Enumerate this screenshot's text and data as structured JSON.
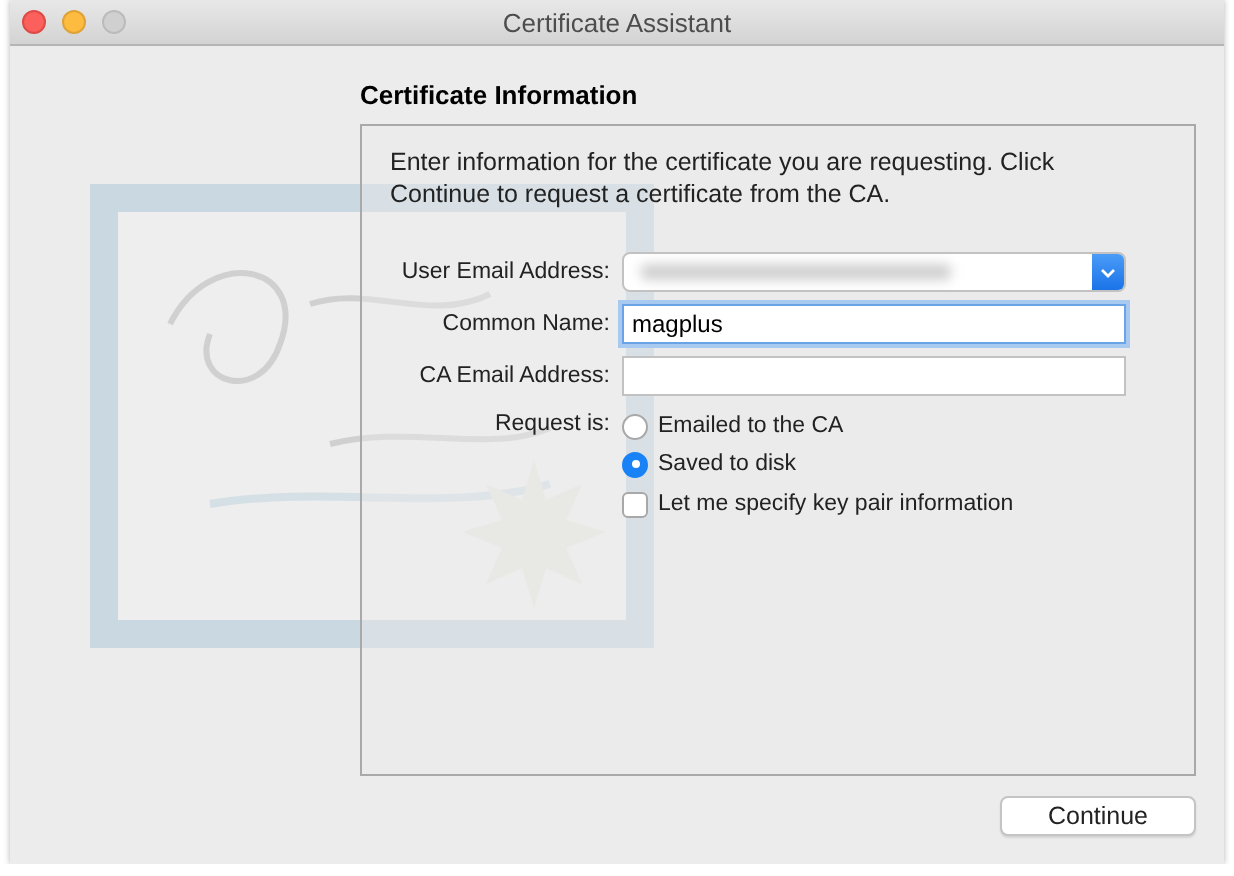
{
  "window": {
    "title": "Certificate Assistant"
  },
  "heading": "Certificate Information",
  "intro": "Enter information for the certificate you are requesting. Click Continue to request a certificate from the CA.",
  "fields": [
    {
      "kind": "dropdown",
      "label": "User Email Address:",
      "redacted": true,
      "focused": false
    },
    {
      "kind": "text",
      "label": "Common Name:",
      "value": "magplus",
      "focused": true
    },
    {
      "kind": "text",
      "label": "CA Email Address:",
      "focused": false
    }
  ],
  "request": {
    "label": "Request is:",
    "options": [
      {
        "label": "Emailed to the CA",
        "selected": false
      },
      {
        "label": "Saved to disk",
        "selected": true
      }
    ]
  },
  "key_pair": {
    "label": "Let me specify key pair information",
    "checked": false
  },
  "buttons": [
    "Continue"
  ]
}
